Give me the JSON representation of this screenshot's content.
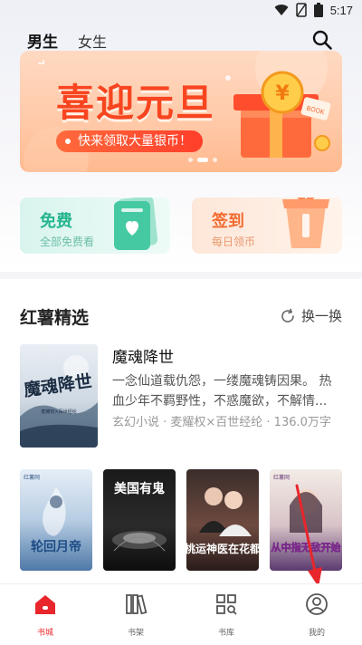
{
  "status_bar": {
    "time": "5:17"
  },
  "gender_tabs": [
    {
      "label": "男生",
      "active": true
    },
    {
      "label": "女生",
      "active": false
    }
  ],
  "banner": {
    "title": "喜迎元旦",
    "subtitle": "快来领取大量银币！",
    "badge": "BOOK",
    "slides": 3,
    "active_slide": 1
  },
  "cards": {
    "free": {
      "title": "免费",
      "subtitle": "全部免费看"
    },
    "signin": {
      "title": "签到",
      "subtitle": "每日领币"
    }
  },
  "section": {
    "title": "红薯精选",
    "refresh_label": "换一换"
  },
  "featured_book": {
    "title": "魔魂降世",
    "description": "一念仙道载仇怨，一缕魔魂铸因果。 热血少年不羁野性，不惑魔欲，不解情...",
    "meta": "玄幻小说 · 麦耀权×百世经纶 · 136.0万字",
    "cover_text": "魔魂降世",
    "cover_sub": "麦耀权×百世经纶"
  },
  "cover_row": [
    {
      "title": "轮回月帝",
      "tag": "红薯网",
      "palette": "blue"
    },
    {
      "title": "美国有鬼",
      "tag": "",
      "palette": "dark"
    },
    {
      "title": "桃运神医在花都",
      "tag": "",
      "palette": "couple"
    },
    {
      "title": "从中指无敌开始",
      "tag": "红薯网",
      "palette": "purple"
    }
  ],
  "bottom_nav": [
    {
      "label": "书城",
      "icon": "home-icon",
      "active": true
    },
    {
      "label": "书架",
      "icon": "bookshelf-icon",
      "active": false
    },
    {
      "label": "书库",
      "icon": "library-icon",
      "active": false
    },
    {
      "label": "我的",
      "icon": "profile-icon",
      "active": false
    }
  ],
  "colors": {
    "accent": "#e8262c",
    "banner_red": "#f8451f",
    "free_green": "#25b58f",
    "signin_orange": "#f26a2e"
  }
}
